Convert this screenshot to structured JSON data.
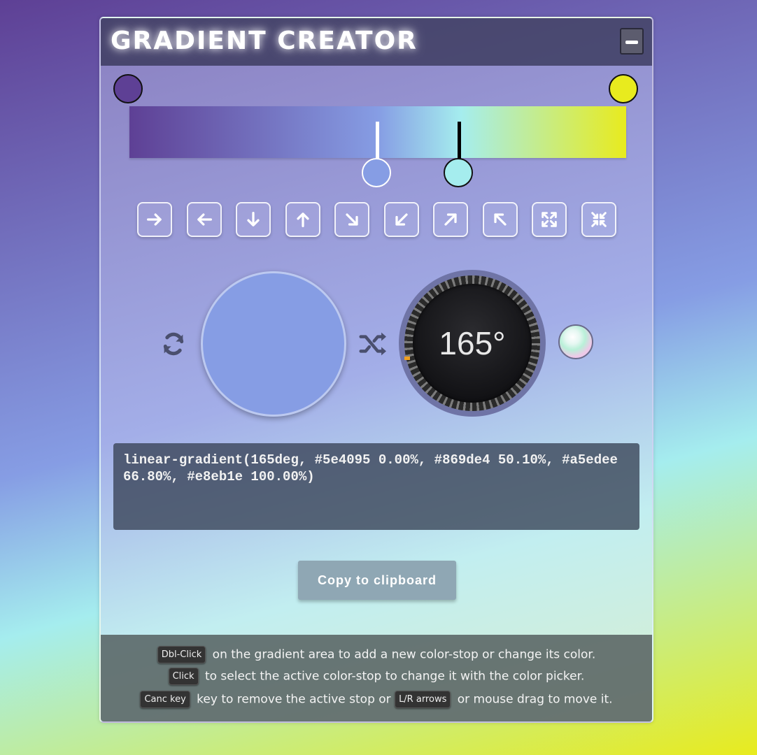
{
  "window": {
    "title": "GRADIENT CREATOR"
  },
  "gradient": {
    "angle_text": "165°",
    "angle_deg": 165,
    "stops": [
      {
        "color": "#5e4095",
        "position_percent": 0.0
      },
      {
        "color": "#869de4",
        "position_percent": 50.1
      },
      {
        "color": "#a5edee",
        "position_percent": 66.8
      },
      {
        "color": "#e8eb1e",
        "position_percent": 100.0
      }
    ]
  },
  "direction_buttons": [
    {
      "icon": "arrow-right-icon"
    },
    {
      "icon": "arrow-left-icon"
    },
    {
      "icon": "arrow-down-icon"
    },
    {
      "icon": "arrow-up-icon"
    },
    {
      "icon": "arrow-down-right-icon"
    },
    {
      "icon": "arrow-down-left-icon"
    },
    {
      "icon": "arrow-up-right-icon"
    },
    {
      "icon": "arrow-up-left-icon"
    },
    {
      "icon": "expand-icon"
    },
    {
      "icon": "compress-icon"
    }
  ],
  "preview_color": "#869de4",
  "css_output": "linear-gradient(165deg, #5e4095 0.00%, #869de4 50.10%, #a5edee 66.80%, #e8eb1e 100.00%)",
  "copy_button_label": "Copy to clipboard",
  "help": {
    "line1_key": "Dbl-Click",
    "line1_text": " on the gradient area to add a new color-stop or change its color.",
    "line2_key": "Click",
    "line2_text": " to select the active color-stop to change it with the color picker.",
    "line3_key1": "Canc key",
    "line3_text1": " key to remove the active stop or ",
    "line3_key2": "L/R arrows",
    "line3_text2": " or mouse drag to move it."
  }
}
